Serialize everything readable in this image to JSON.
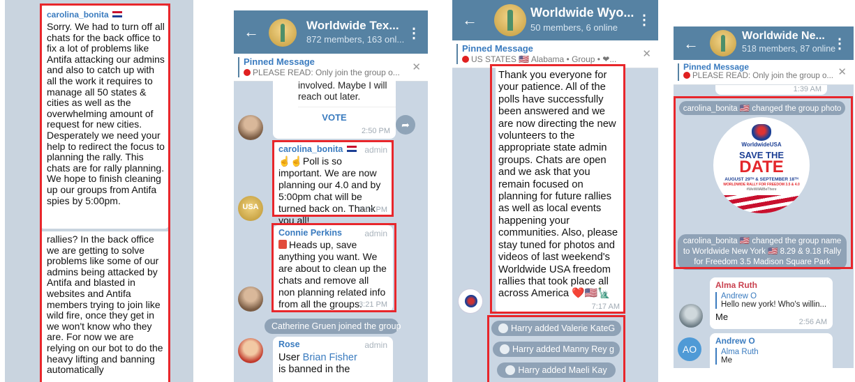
{
  "panel1": {
    "sender": "carolina_bonita",
    "text_top": "Sorry. We had to turn off all chats for the back office to fix a lot of problems like Antifa attacking our admins and also to catch up with all the work it requires to manage all 50 states & cities as well as the overwhelming amount of request for new cities. Desperately we need your help to redirect the focus to planning the rally. This chats are for rally planning. We hope to finish cleaning up our groups from Antifa spies by 5:00pm.",
    "text_bottom": "rallies? In the back office we are getting to solve problems like some of our admins being attacked by Antifa and blasted in websites and Antifa members trying to join like wild fire, once they get in we won't know who they are. For now we are relying on our bot to do the heavy lifting and banning automatically"
  },
  "panel2": {
    "title": "Worldwide Tex...",
    "subtitle": "872 members, 163 onl...",
    "pinned_title": "Pinned Message",
    "pinned_preview": "PLEASE READ:  Only join the group o...",
    "poll_text": "involved. Maybe I will reach out later.",
    "vote_label": "VOTE",
    "poll_time": "2:50 PM",
    "msg1": {
      "sender": "carolina_bonita",
      "role": "admin",
      "text": "☝☝Poll is so important. We are now planning our 4.0 and by 5:00pm chat will be turned back on. Thank you all!",
      "time": "3:04 PM"
    },
    "msg2": {
      "sender": "Connie Perkins",
      "role": "admin",
      "text": "Heads up, save anything you want. We are about to clean up the chats and remove all non planning related info from all the groups.",
      "time": "3:21 PM"
    },
    "service": "Catherine Gruen joined the group",
    "msg3": {
      "sender": "Rose",
      "role": "admin",
      "text_prefix": "User ",
      "link": "Brian Fisher",
      "text_suffix": "is banned in the"
    }
  },
  "panel3": {
    "title": "Worldwide Wyo...",
    "subtitle": "50 members, 6 online",
    "pinned_title": "Pinned Message",
    "pinned_preview": "US STATES  🇺🇸 Alabama • Group • ❤...",
    "text": "Thank you everyone for your patience. All of the polls have successfully been answered and we are now directing the new volunteers to the appropriate state admin groups. Chats are open and we ask that you remain focused on planning for future rallies as well as local events happening your communities. Also, please stay tuned for photos and videos of last weekend's Worldwide USA freedom rallies that took place all across America ❤️🇺🇸🗽",
    "time": "7:17 AM",
    "services": [
      "Harry added Valerie KateG",
      "Harry added Manny Rey g",
      "Harry added Maeli Kay"
    ]
  },
  "panel4": {
    "title": "Worldwide Ne...",
    "subtitle": "518 members, 87 online",
    "pinned_title": "Pinned Message",
    "pinned_preview": "PLEASE READ:  Only join the group o...",
    "top_time": "1:39 AM",
    "svc_photo": "carolina_bonita 🇺🇸 changed the group photo",
    "photo": {
      "brand": "WorldwideUSA",
      "line1": "SAVE THE",
      "line2": "DATE",
      "dates": "AUGUST 29ᵀᴴ & SEPTEMBER 18ᵀᴴ",
      "rally": "WORLDWIDE RALLY FOR FREEDOM 3.5 & 4.0",
      "tag": "#WeWillAllBeThere"
    },
    "svc_name": "carolina_bonita 🇺🇸 changed the group name to Worldwide New York 🇺🇸 8.29 & 9.18 Rally for Freedom 3.5 Madison Square Park",
    "msg1": {
      "sender": "Alma Ruth",
      "reply_name": "Andrew O",
      "reply_text": "Hello new york! Who's willin...",
      "text": "Me",
      "time": "2:56 AM"
    },
    "msg2": {
      "initials": "AO",
      "sender": "Andrew O",
      "reply_name": "Alma Ruth",
      "reply_text": "Me"
    }
  },
  "colors": {
    "highlight": "#e8262b",
    "header": "#5682a3",
    "link": "#3a7bbf"
  }
}
